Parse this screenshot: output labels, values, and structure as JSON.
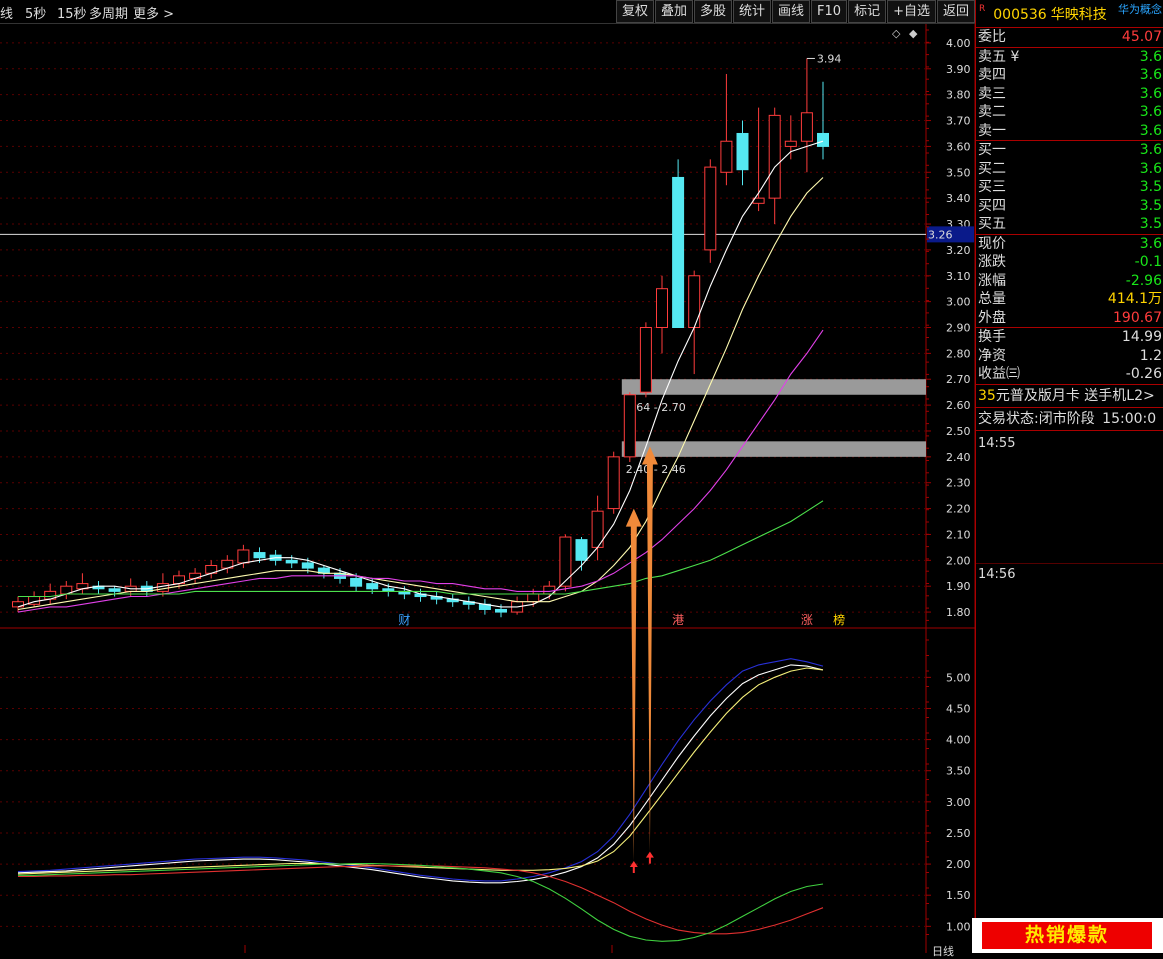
{
  "toolbar": {
    "left": [
      "线",
      "5秒",
      "15秒",
      "多周期",
      "更多 >"
    ],
    "right": [
      "复权",
      "叠加",
      "多股",
      "统计",
      "画线",
      "F10",
      "标记",
      "+自选",
      "返回"
    ]
  },
  "colors": {
    "up": "#ff3c3c",
    "down": "#55e8f2",
    "ma1": "#ffffff",
    "ma2": "#fffbb0",
    "ma3": "#e040e8",
    "ma4": "#4ce04c",
    "grid": "#a00000"
  },
  "price_chart": {
    "y_ticks": [
      "4.00",
      "3.90",
      "3.80",
      "3.70",
      "3.60",
      "3.50",
      "3.40",
      "3.30",
      "3.20",
      "3.10",
      "3.00",
      "2.90",
      "2.80",
      "2.70",
      "2.60",
      "2.50",
      "2.40",
      "2.30",
      "2.20",
      "2.10",
      "2.00",
      "1.90",
      "1.80"
    ],
    "current_price_label": "3.26",
    "high_label": "3.94",
    "zone_labels": [
      "2.64 - 2.70",
      "2.40 - 2.46"
    ],
    "event_labels": [
      "财",
      "港",
      "涨",
      "榜"
    ]
  },
  "indicator_chart": {
    "y_ticks": [
      "5.00",
      "4.50",
      "4.00",
      "3.50",
      "3.00",
      "2.50",
      "2.00",
      "1.50",
      "1.00"
    ]
  },
  "chart_data": {
    "type": "candlestick",
    "ylim": [
      1.75,
      4.05
    ],
    "candles": [
      [
        1.82,
        1.84,
        1.8,
        1.86
      ],
      [
        1.83,
        1.86,
        1.82,
        1.88
      ],
      [
        1.85,
        1.88,
        1.83,
        1.91
      ],
      [
        1.87,
        1.9,
        1.85,
        1.92
      ],
      [
        1.89,
        1.91,
        1.87,
        1.95
      ],
      [
        1.9,
        1.89,
        1.87,
        1.92
      ],
      [
        1.89,
        1.88,
        1.86,
        1.9
      ],
      [
        1.88,
        1.9,
        1.86,
        1.93
      ],
      [
        1.9,
        1.88,
        1.86,
        1.92
      ],
      [
        1.88,
        1.91,
        1.86,
        1.95
      ],
      [
        1.91,
        1.94,
        1.89,
        1.96
      ],
      [
        1.93,
        1.95,
        1.91,
        1.97
      ],
      [
        1.95,
        1.98,
        1.93,
        2.0
      ],
      [
        1.97,
        2.0,
        1.95,
        2.02
      ],
      [
        1.99,
        2.04,
        1.97,
        2.06
      ],
      [
        2.03,
        2.01,
        1.99,
        2.05
      ],
      [
        2.02,
        2.0,
        1.98,
        2.04
      ],
      [
        2.0,
        1.99,
        1.97,
        2.02
      ],
      [
        1.99,
        1.97,
        1.95,
        2.01
      ],
      [
        1.97,
        1.95,
        1.93,
        1.98
      ],
      [
        1.95,
        1.93,
        1.91,
        1.97
      ],
      [
        1.93,
        1.9,
        1.88,
        1.95
      ],
      [
        1.91,
        1.89,
        1.87,
        1.93
      ],
      [
        1.89,
        1.88,
        1.86,
        1.91
      ],
      [
        1.88,
        1.87,
        1.85,
        1.9
      ],
      [
        1.87,
        1.86,
        1.84,
        1.89
      ],
      [
        1.86,
        1.85,
        1.83,
        1.88
      ],
      [
        1.85,
        1.84,
        1.82,
        1.87
      ],
      [
        1.84,
        1.83,
        1.81,
        1.86
      ],
      [
        1.83,
        1.81,
        1.79,
        1.85
      ],
      [
        1.81,
        1.8,
        1.78,
        1.83
      ],
      [
        1.8,
        1.84,
        1.79,
        1.86
      ],
      [
        1.84,
        1.87,
        1.82,
        1.89
      ],
      [
        1.87,
        1.9,
        1.85,
        1.92
      ],
      [
        1.9,
        2.09,
        1.88,
        2.1
      ],
      [
        2.08,
        2.0,
        1.96,
        2.09
      ],
      [
        2.05,
        2.19,
        2.0,
        2.25
      ],
      [
        2.2,
        2.4,
        2.18,
        2.42
      ],
      [
        2.4,
        2.64,
        2.38,
        2.65
      ],
      [
        2.65,
        2.9,
        2.63,
        2.92
      ],
      [
        2.9,
        3.05,
        2.8,
        3.1
      ],
      [
        3.48,
        2.9,
        2.9,
        3.55
      ],
      [
        2.9,
        3.1,
        2.72,
        3.12
      ],
      [
        3.2,
        3.52,
        3.15,
        3.55
      ],
      [
        3.5,
        3.62,
        3.45,
        3.88
      ],
      [
        3.65,
        3.51,
        3.45,
        3.7
      ],
      [
        3.38,
        3.4,
        3.35,
        3.75
      ],
      [
        3.4,
        3.72,
        3.3,
        3.75
      ],
      [
        3.6,
        3.62,
        3.55,
        3.72
      ],
      [
        3.62,
        3.73,
        3.5,
        3.94
      ],
      [
        3.65,
        3.6,
        3.55,
        3.85
      ]
    ],
    "ma_short": [
      1.82,
      1.84,
      1.85,
      1.87,
      1.89,
      1.9,
      1.9,
      1.89,
      1.89,
      1.9,
      1.91,
      1.93,
      1.95,
      1.97,
      1.99,
      2.0,
      2.01,
      2.01,
      2.0,
      1.98,
      1.96,
      1.94,
      1.92,
      1.9,
      1.89,
      1.87,
      1.86,
      1.85,
      1.84,
      1.83,
      1.82,
      1.82,
      1.83,
      1.86,
      1.92,
      1.98,
      2.05,
      2.14,
      2.27,
      2.44,
      2.62,
      2.77,
      2.9,
      3.06,
      3.2,
      3.33,
      3.42,
      3.52,
      3.58,
      3.6,
      3.62
    ],
    "ma_mid": [
      1.81,
      1.82,
      1.83,
      1.84,
      1.85,
      1.86,
      1.87,
      1.88,
      1.88,
      1.89,
      1.9,
      1.91,
      1.92,
      1.93,
      1.94,
      1.95,
      1.96,
      1.96,
      1.96,
      1.95,
      1.95,
      1.94,
      1.93,
      1.92,
      1.91,
      1.9,
      1.89,
      1.88,
      1.87,
      1.86,
      1.85,
      1.84,
      1.84,
      1.84,
      1.86,
      1.88,
      1.92,
      1.98,
      2.05,
      2.15,
      2.28,
      2.4,
      2.54,
      2.68,
      2.82,
      2.97,
      3.1,
      3.22,
      3.33,
      3.42,
      3.48
    ],
    "ma_long": [
      1.8,
      1.81,
      1.82,
      1.82,
      1.83,
      1.84,
      1.85,
      1.86,
      1.86,
      1.87,
      1.88,
      1.89,
      1.9,
      1.91,
      1.92,
      1.93,
      1.93,
      1.94,
      1.94,
      1.94,
      1.94,
      1.94,
      1.93,
      1.93,
      1.92,
      1.92,
      1.91,
      1.91,
      1.9,
      1.89,
      1.89,
      1.88,
      1.88,
      1.88,
      1.89,
      1.9,
      1.92,
      1.95,
      1.99,
      2.03,
      2.08,
      2.14,
      2.2,
      2.27,
      2.35,
      2.44,
      2.53,
      2.62,
      2.72,
      2.8,
      2.89
    ],
    "ma_xlong": [
      1.86,
      1.86,
      1.86,
      1.87,
      1.87,
      1.87,
      1.87,
      1.87,
      1.87,
      1.87,
      1.87,
      1.88,
      1.88,
      1.88,
      1.88,
      1.88,
      1.88,
      1.88,
      1.88,
      1.88,
      1.88,
      1.88,
      1.88,
      1.88,
      1.88,
      1.88,
      1.88,
      1.87,
      1.87,
      1.87,
      1.87,
      1.87,
      1.87,
      1.87,
      1.87,
      1.88,
      1.89,
      1.9,
      1.91,
      1.93,
      1.94,
      1.96,
      1.98,
      2.0,
      2.03,
      2.06,
      2.09,
      2.12,
      2.15,
      2.19,
      2.23
    ],
    "indicator": {
      "ylim": [
        0.7,
        5.6
      ],
      "line_blue": [
        1.88,
        1.89,
        1.9,
        1.92,
        1.94,
        1.96,
        1.98,
        2.0,
        2.02,
        2.04,
        2.06,
        2.08,
        2.09,
        2.1,
        2.11,
        2.11,
        2.1,
        2.08,
        2.06,
        2.03,
        2.0,
        1.97,
        1.94,
        1.9,
        1.86,
        1.82,
        1.79,
        1.76,
        1.74,
        1.73,
        1.73,
        1.76,
        1.8,
        1.86,
        1.94,
        2.04,
        2.2,
        2.45,
        2.8,
        3.2,
        3.6,
        3.98,
        4.32,
        4.62,
        4.88,
        5.1,
        5.2,
        5.25,
        5.3,
        5.25,
        5.18
      ],
      "line_white": [
        1.86,
        1.87,
        1.88,
        1.89,
        1.91,
        1.93,
        1.95,
        1.97,
        1.99,
        2.01,
        2.03,
        2.05,
        2.06,
        2.07,
        2.08,
        2.08,
        2.07,
        2.05,
        2.03,
        2.0,
        1.97,
        1.94,
        1.91,
        1.87,
        1.83,
        1.79,
        1.76,
        1.73,
        1.71,
        1.7,
        1.7,
        1.72,
        1.75,
        1.8,
        1.87,
        1.96,
        2.1,
        2.32,
        2.62,
        2.98,
        3.35,
        3.72,
        4.06,
        4.38,
        4.66,
        4.9,
        5.04,
        5.12,
        5.2,
        5.18,
        5.12
      ],
      "line_yellow": [
        1.84,
        1.85,
        1.86,
        1.87,
        1.88,
        1.89,
        1.9,
        1.91,
        1.92,
        1.93,
        1.94,
        1.95,
        1.96,
        1.97,
        1.98,
        1.99,
        2.0,
        2.01,
        2.01,
        2.01,
        2.0,
        1.99,
        1.98,
        1.97,
        1.96,
        1.95,
        1.94,
        1.93,
        1.92,
        1.91,
        1.9,
        1.9,
        1.9,
        1.91,
        1.93,
        1.97,
        2.05,
        2.2,
        2.45,
        2.78,
        3.12,
        3.46,
        3.8,
        4.12,
        4.42,
        4.68,
        4.88,
        5.0,
        5.1,
        5.15,
        5.12
      ],
      "line_red": [
        1.8,
        1.8,
        1.81,
        1.81,
        1.82,
        1.82,
        1.83,
        1.83,
        1.84,
        1.85,
        1.86,
        1.87,
        1.88,
        1.89,
        1.9,
        1.91,
        1.92,
        1.93,
        1.94,
        1.95,
        1.96,
        1.96,
        1.97,
        1.97,
        1.97,
        1.97,
        1.97,
        1.96,
        1.95,
        1.94,
        1.92,
        1.9,
        1.86,
        1.8,
        1.72,
        1.62,
        1.5,
        1.38,
        1.24,
        1.12,
        1.02,
        0.94,
        0.9,
        0.88,
        0.88,
        0.9,
        0.95,
        1.02,
        1.1,
        1.2,
        1.3
      ],
      "line_green": [
        1.82,
        1.82,
        1.83,
        1.84,
        1.85,
        1.86,
        1.87,
        1.88,
        1.89,
        1.9,
        1.91,
        1.92,
        1.93,
        1.94,
        1.95,
        1.96,
        1.97,
        1.98,
        1.99,
        2.0,
        2.0,
        2.01,
        2.01,
        2.0,
        1.99,
        1.98,
        1.96,
        1.94,
        1.92,
        1.89,
        1.86,
        1.8,
        1.72,
        1.6,
        1.45,
        1.28,
        1.1,
        0.95,
        0.84,
        0.78,
        0.76,
        0.77,
        0.82,
        0.9,
        1.02,
        1.16,
        1.3,
        1.44,
        1.56,
        1.64,
        1.68
      ]
    }
  },
  "quote_panel": {
    "code": "000536",
    "name": "华映科技",
    "concept": "华为概念",
    "rows": [
      {
        "label": "委比",
        "value": "45.07",
        "color": "red"
      },
      {
        "label": "卖五 ¥",
        "value": "3.6",
        "color": "green"
      },
      {
        "label": "卖四",
        "value": "3.6",
        "color": "green"
      },
      {
        "label": "卖三",
        "value": "3.6",
        "color": "green"
      },
      {
        "label": "卖二",
        "value": "3.6",
        "color": "green"
      },
      {
        "label": "卖一",
        "value": "3.6",
        "color": "green"
      },
      {
        "label": "买一",
        "value": "3.6",
        "color": "green"
      },
      {
        "label": "买二",
        "value": "3.6",
        "color": "green"
      },
      {
        "label": "买三",
        "value": "3.5",
        "color": "green"
      },
      {
        "label": "买四",
        "value": "3.5",
        "color": "green"
      },
      {
        "label": "买五",
        "value": "3.5",
        "color": "green"
      },
      {
        "label": "现价",
        "value": "3.6",
        "color": "green"
      },
      {
        "label": "涨跌",
        "value": "-0.1",
        "color": "green"
      },
      {
        "label": "涨幅",
        "value": "-2.96",
        "color": "green"
      },
      {
        "label": "总量",
        "value": "414.1万",
        "color": "yellow"
      },
      {
        "label": "外盘",
        "value": "190.67",
        "color": "red"
      },
      {
        "label": "换手",
        "value": "14.99",
        "color": "white"
      },
      {
        "label": "净资",
        "value": "1.2",
        "color": "white"
      },
      {
        "label": "收益㈢",
        "value": "-0.26",
        "color": "white"
      }
    ],
    "ad_price": "35",
    "ad_text": "元普及版月卡 送手机L2>",
    "status_label": "交易状态:",
    "status_value": "闭市阶段",
    "status_time": "15:00:0",
    "time_1": "14:55",
    "time_2": "14:56",
    "bottom_tab": "日线",
    "promo": "热销爆款"
  }
}
